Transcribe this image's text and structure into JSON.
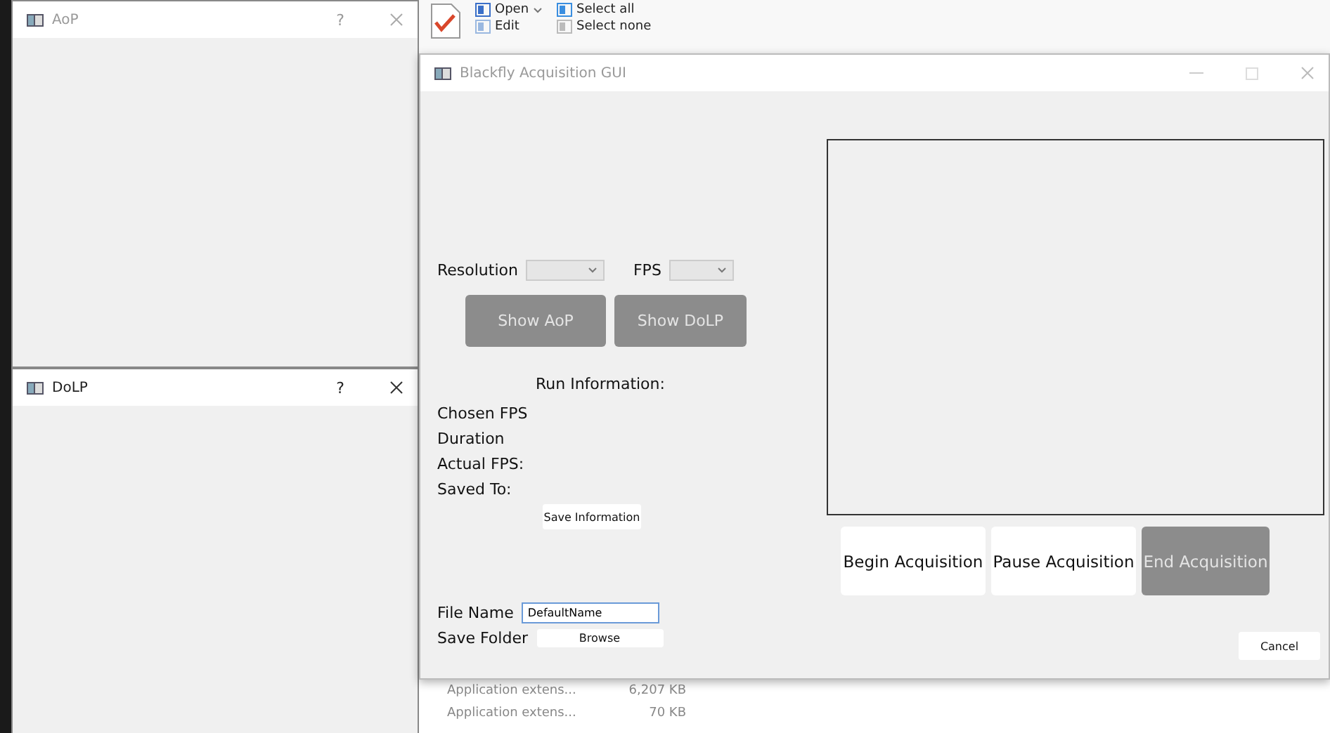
{
  "explorer": {
    "ribbon": [
      {
        "label": "Open",
        "kind": "dropdown"
      },
      {
        "label": "Edit",
        "kind": "plain"
      },
      {
        "label": "Select all",
        "kind": "plain"
      },
      {
        "label": "Select none",
        "kind": "plain"
      }
    ],
    "files": [
      {
        "name": "Application extens...",
        "size": "6,207 KB"
      },
      {
        "name": "Application extens...",
        "size": "70 KB"
      }
    ]
  },
  "child_windows": [
    {
      "title": "AoP",
      "help": "?"
    },
    {
      "title": "DoLP",
      "help": "?"
    }
  ],
  "main_window": {
    "title": "Blackfly Acquisition GUI",
    "selectors": [
      {
        "label": "Resolution"
      },
      {
        "label": "FPS"
      }
    ],
    "view_buttons": [
      {
        "label": "Show AoP",
        "disabled": true
      },
      {
        "label": "Show DoLP",
        "disabled": true
      }
    ],
    "run_info_title": "Run Information:",
    "run_info": [
      "Chosen FPS",
      "Duration",
      "Actual FPS:",
      "Saved To:"
    ],
    "save_info_button": "Save Information",
    "acquisition_buttons": [
      {
        "label": "Begin Acquisition",
        "disabled": false
      },
      {
        "label": "Pause Acquisition",
        "disabled": false
      },
      {
        "label": "End Acquisition",
        "disabled": true
      }
    ],
    "file_name": {
      "label": "File Name",
      "value": "DefaultName"
    },
    "save_folder": {
      "label": "Save Folder",
      "button": "Browse"
    },
    "cancel": "Cancel"
  }
}
